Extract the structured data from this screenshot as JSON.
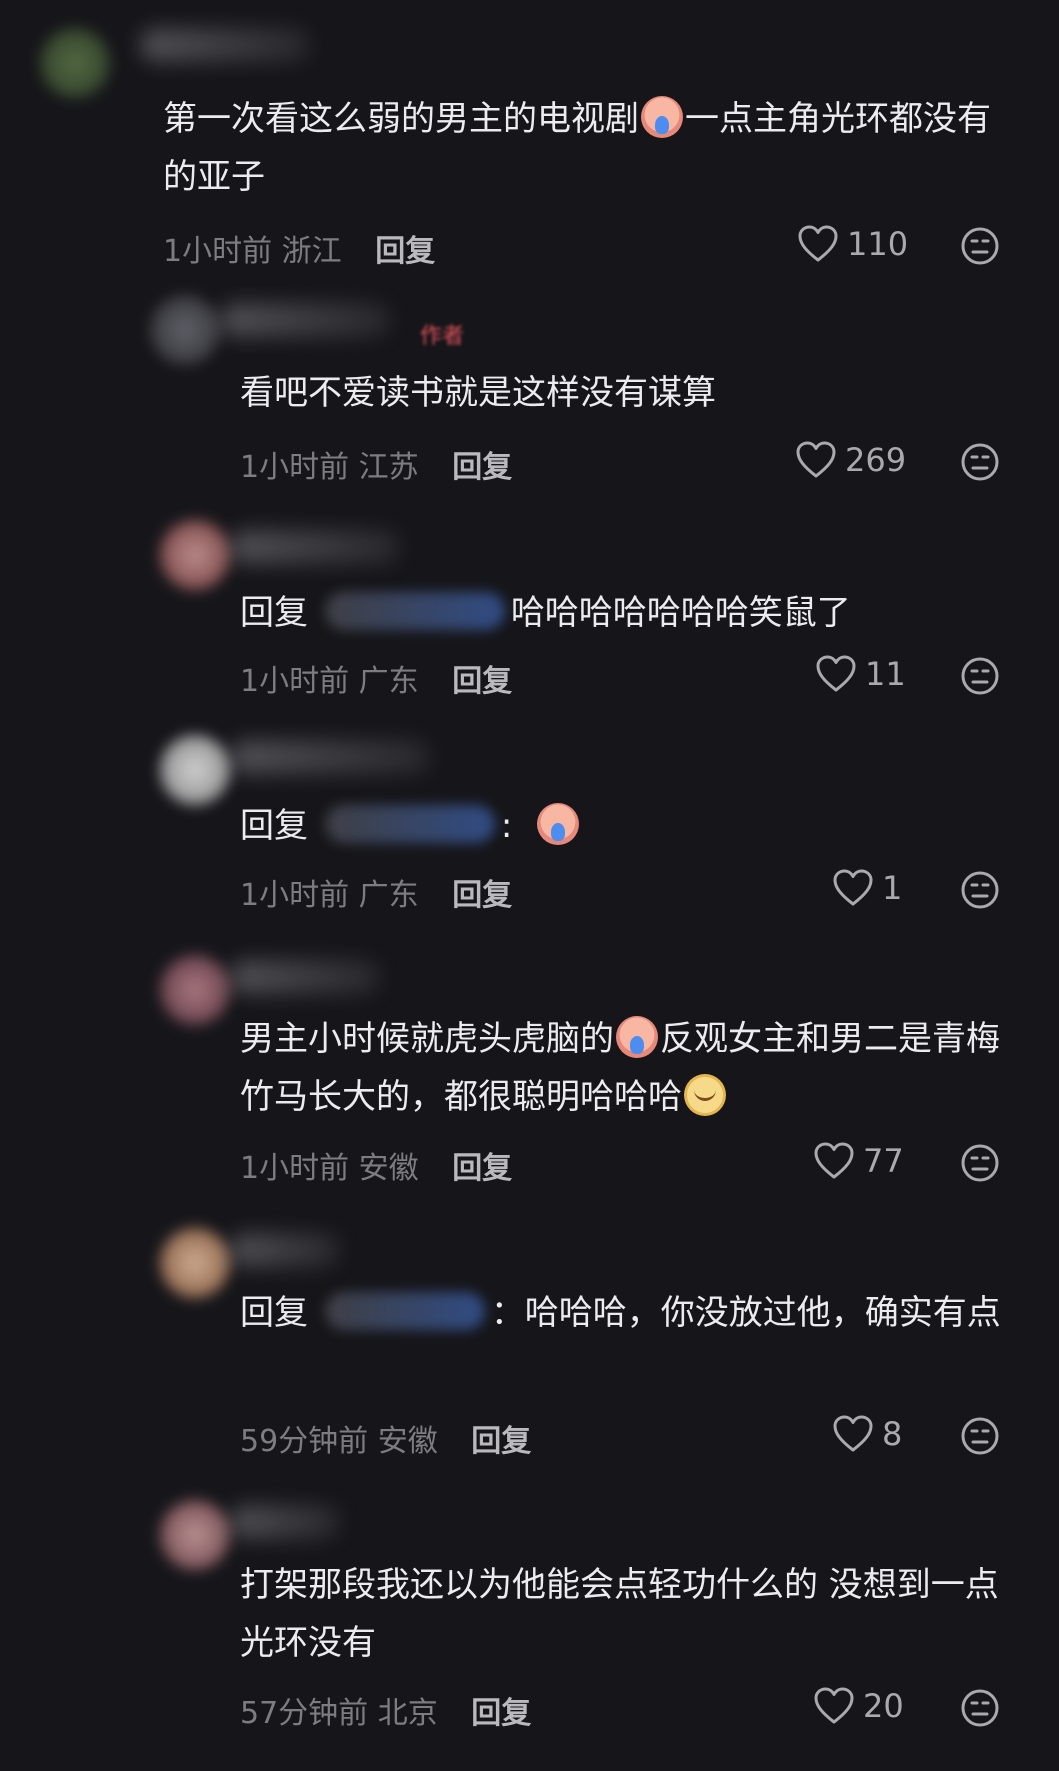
{
  "comments": [
    {
      "text_before": "第一次看这么弱的男主的电视剧",
      "emoji_mid": "cry-emoji",
      "text_after": "一点主角光环都没有的亚子",
      "time": "1小时前",
      "location": "浙江",
      "reply_label": "回复",
      "likes": "110"
    },
    {
      "text": "看吧不爱读书就是这样没有谋算",
      "badge": "作者",
      "time": "1小时前",
      "location": "江苏",
      "reply_label": "回复",
      "likes": "269"
    },
    {
      "prefix": "回复",
      "text": "哈哈哈哈哈哈哈笑鼠了",
      "time": "1小时前",
      "location": "广东",
      "reply_label": "回复",
      "likes": "11"
    },
    {
      "prefix": "回复",
      "colon": ":",
      "emoji": "cry-emoji",
      "time": "1小时前",
      "location": "广东",
      "reply_label": "回复",
      "likes": "1"
    },
    {
      "text_before": "男主小时候就虎头虎脑的",
      "text_mid": "反观女主和男二是青梅竹马长大的，都很聪明哈哈哈",
      "time": "1小时前",
      "location": "安徽",
      "reply_label": "回复",
      "likes": "77"
    },
    {
      "prefix": "回复",
      "text": "：哈哈哈，你没放过他，确实有点",
      "time": "59分钟前",
      "location": "安徽",
      "reply_label": "回复",
      "likes": "8"
    },
    {
      "text": "打架那段我还以为他能会点轻功什么的 没想到一点光环没有",
      "time": "57分钟前",
      "location": "北京",
      "reply_label": "回复",
      "likes": "20"
    }
  ]
}
